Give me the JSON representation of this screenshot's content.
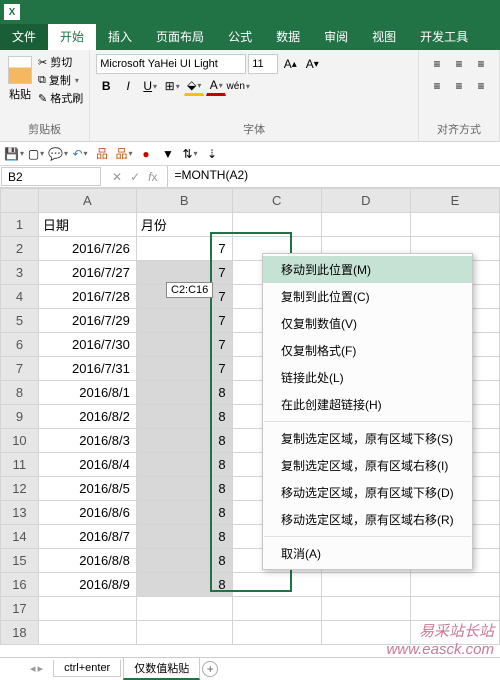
{
  "tabs": {
    "file": "文件",
    "home": "开始",
    "insert": "插入",
    "layout": "页面布局",
    "formulas": "公式",
    "data": "数据",
    "review": "审阅",
    "view": "视图",
    "dev": "开发工具"
  },
  "ribbon": {
    "paste": "粘贴",
    "cut": "剪切",
    "copy": "复制",
    "format_painter": "格式刷",
    "clipboard": "剪贴板",
    "font_name": "Microsoft YaHei UI Light",
    "font_size": "11",
    "font_label": "字体",
    "align_label": "对齐方式"
  },
  "name_box": "B2",
  "formula": "=MONTH(A2)",
  "tooltip": "C2:C16",
  "columns": [
    "A",
    "B",
    "C",
    "D",
    "E"
  ],
  "hdr": {
    "date": "日期",
    "month": "月份"
  },
  "rows": [
    {
      "n": "1"
    },
    {
      "n": "2",
      "a": "2016/7/26",
      "b": "7"
    },
    {
      "n": "3",
      "a": "2016/7/27",
      "b": "7"
    },
    {
      "n": "4",
      "a": "2016/7/28",
      "b": "7"
    },
    {
      "n": "5",
      "a": "2016/7/29",
      "b": "7"
    },
    {
      "n": "6",
      "a": "2016/7/30",
      "b": "7"
    },
    {
      "n": "7",
      "a": "2016/7/31",
      "b": "7"
    },
    {
      "n": "8",
      "a": "2016/8/1",
      "b": "8"
    },
    {
      "n": "9",
      "a": "2016/8/2",
      "b": "8"
    },
    {
      "n": "10",
      "a": "2016/8/3",
      "b": "8"
    },
    {
      "n": "11",
      "a": "2016/8/4",
      "b": "8"
    },
    {
      "n": "12",
      "a": "2016/8/5",
      "b": "8"
    },
    {
      "n": "13",
      "a": "2016/8/6",
      "b": "8"
    },
    {
      "n": "14",
      "a": "2016/8/7",
      "b": "8"
    },
    {
      "n": "15",
      "a": "2016/8/8",
      "b": "8"
    },
    {
      "n": "16",
      "a": "2016/8/9",
      "b": "8"
    },
    {
      "n": "17"
    },
    {
      "n": "18"
    }
  ],
  "ctx": {
    "move_here": "移动到此位置(M)",
    "copy_here": "复制到此位置(C)",
    "values_only": "仅复制数值(V)",
    "formats_only": "仅复制格式(F)",
    "link_here": "链接此处(L)",
    "hyperlink": "在此创建超链接(H)",
    "copy_shift_down": "复制选定区域，原有区域下移(S)",
    "copy_shift_right": "复制选定区域，原有区域右移(I)",
    "move_shift_down": "移动选定区域，原有区域下移(D)",
    "move_shift_right": "移动选定区域，原有区域右移(R)",
    "cancel": "取消(A)"
  },
  "sheets": {
    "s1": "ctrl+enter",
    "s2": "仅数值粘贴"
  },
  "watermark": {
    "l1": "易采站长站",
    "l2": "www.easck.com"
  }
}
